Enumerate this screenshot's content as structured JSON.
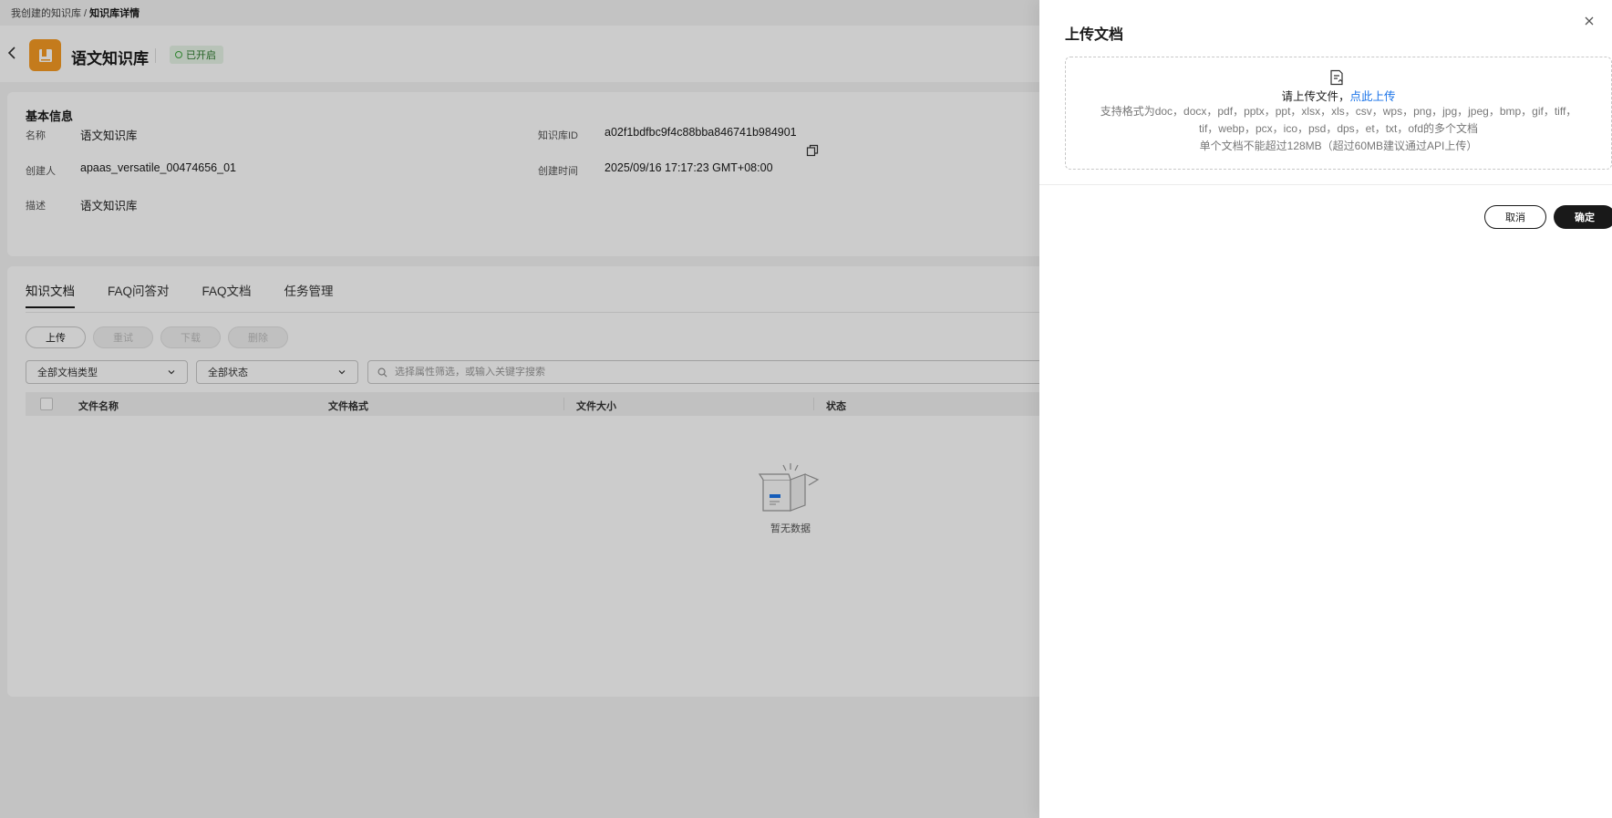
{
  "breadcrumb": {
    "parent": "我创建的知识库",
    "separator": " / ",
    "current": "知识库详情"
  },
  "header": {
    "title": "语文知识库",
    "status": "已开启"
  },
  "basic_info": {
    "title": "基本信息",
    "name_label": "名称",
    "name_value": "语文知识库",
    "id_label": "知识库ID",
    "id_value": "a02f1bdfbc9f4c88bba846741b984901",
    "creator_label": "创建人",
    "creator_value": "apaas_versatile_00474656_01",
    "created_label": "创建时间",
    "created_value": "2025/09/16 17:17:23 GMT+08:00",
    "desc_label": "描述",
    "desc_value": "语文知识库"
  },
  "tabs": [
    "知识文档",
    "FAQ问答对",
    "FAQ文档",
    "任务管理"
  ],
  "actions": {
    "upload": "上传",
    "retry": "重试",
    "download": "下载",
    "delete": "删除"
  },
  "filters": {
    "doc_type": "全部文档类型",
    "status": "全部状态",
    "search_placeholder": "选择属性筛选，或输入关键字搜索"
  },
  "table": {
    "columns": [
      "文件名称",
      "文件格式",
      "文件大小",
      "状态"
    ],
    "empty_text": "暂无数据"
  },
  "drawer": {
    "title": "上传文档",
    "prompt": "请上传文件，",
    "link": "点此上传",
    "formats_line1": "支持格式为doc，docx，pdf，pptx，ppt，xlsx，xls，csv，wps，png，jpg，jpeg，bmp，gif，tiff，",
    "formats_line2": "tif，webp，pcx，ico，psd，dps，et，txt，ofd的多个文档",
    "size_limit": "单个文档不能超过128MB（超过60MB建议通过API上传）",
    "cancel": "取消",
    "confirm": "确定"
  },
  "colors": {
    "accent_orange": "#f59a23",
    "link_blue": "#1a73e8",
    "primary_dark": "#191919",
    "status_green": "#3aa53a"
  }
}
